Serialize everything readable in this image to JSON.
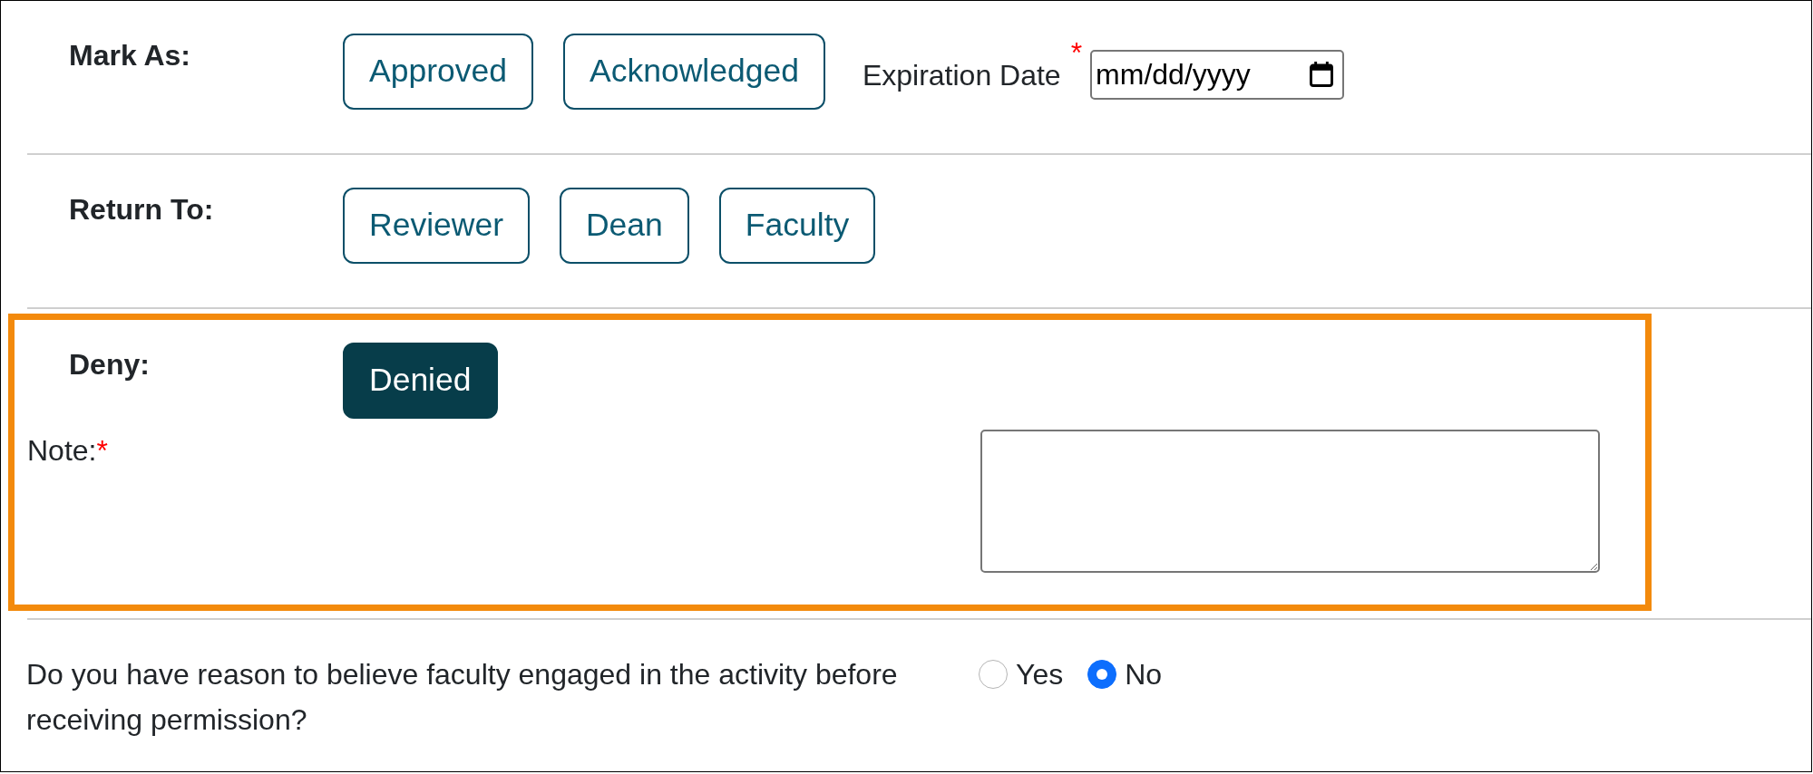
{
  "sections": [
    {
      "label": "Mark As:",
      "buttons": [
        {
          "label": "Approved",
          "selected": false
        },
        {
          "label": "Acknowledged",
          "selected": false
        }
      ],
      "date_field": {
        "label": "Expiration Date",
        "required_mark": "*",
        "placeholder": "mm/dd/yyyy"
      }
    },
    {
      "label": "Return To:",
      "buttons": [
        {
          "label": "Reviewer",
          "selected": false
        },
        {
          "label": "Dean",
          "selected": false
        },
        {
          "label": "Faculty",
          "selected": false
        }
      ]
    },
    {
      "label": "Deny:",
      "highlighted": true,
      "buttons": [
        {
          "label": "Denied",
          "selected": true
        }
      ],
      "note": {
        "label": "Note:",
        "required_mark": "*"
      }
    }
  ],
  "question": {
    "text": "Do you have reason to believe faculty engaged in the activity before receiving permission?",
    "options": [
      {
        "label": "Yes",
        "selected": false
      },
      {
        "label": "No",
        "selected": true
      }
    ]
  }
}
